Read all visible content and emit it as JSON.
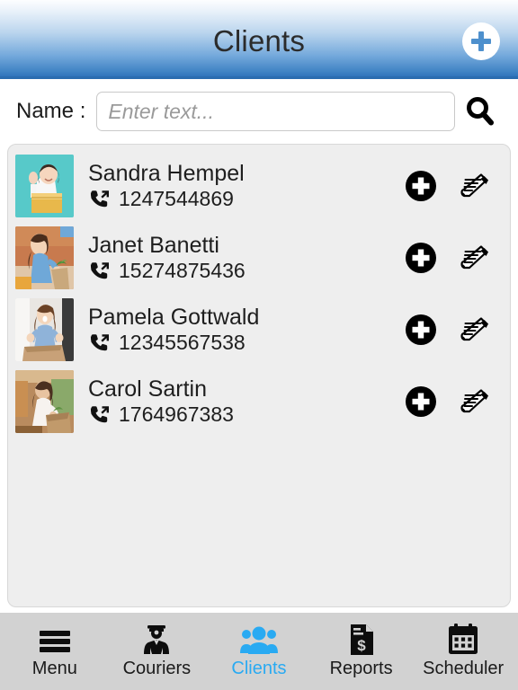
{
  "header": {
    "title": "Clients",
    "add_icon": "plus-circle-icon",
    "accent_blue": "#2f74bb",
    "title_color": "#2b2b2b"
  },
  "search": {
    "label": "Name :",
    "value": "",
    "placeholder": "Enter text...",
    "search_icon": "search-icon"
  },
  "clients": [
    {
      "name": "Sandra Hempel",
      "phone": "1247544869",
      "phone_icon": "outgoing-call-icon",
      "add_icon": "plus-circle-icon",
      "edit_icon": "edit-document-icon",
      "avatar": "woman-with-yellow-box-on-teal"
    },
    {
      "name": "Janet Banetti",
      "phone": "15274875436",
      "phone_icon": "outgoing-call-icon",
      "add_icon": "plus-circle-icon",
      "edit_icon": "edit-document-icon",
      "avatar": "woman-with-grocery-bag"
    },
    {
      "name": "Pamela Gottwald",
      "phone": "12345567538",
      "phone_icon": "outgoing-call-icon",
      "add_icon": "plus-circle-icon",
      "edit_icon": "edit-document-icon",
      "avatar": "woman-receiving-parcel"
    },
    {
      "name": "Carol Sartin",
      "phone": "1764967383",
      "phone_icon": "outgoing-call-icon",
      "add_icon": "plus-circle-icon",
      "edit_icon": "edit-document-icon",
      "avatar": "woman-opening-package-outdoors"
    }
  ],
  "bottom_nav": {
    "active_color": "#29aaf2",
    "items": [
      {
        "label": "Menu",
        "icon": "hamburger-menu-icon",
        "active": false
      },
      {
        "label": "Couriers",
        "icon": "courier-person-icon",
        "active": false
      },
      {
        "label": "Clients",
        "icon": "people-group-icon",
        "active": true
      },
      {
        "label": "Reports",
        "icon": "document-dollar-icon",
        "active": false
      },
      {
        "label": "Scheduler",
        "icon": "calendar-icon",
        "active": false
      }
    ]
  }
}
